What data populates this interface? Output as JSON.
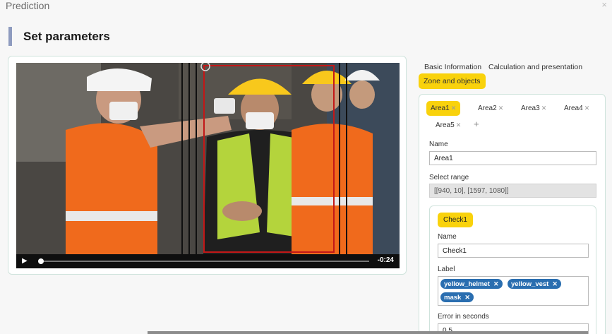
{
  "window": {
    "title": "Prediction",
    "close_icon": "close-icon"
  },
  "header": {
    "title": "Set parameters",
    "accent_color": "#8e9bbf"
  },
  "video": {
    "time_remaining": "-0:24",
    "progress": 0.0
  },
  "tabs": [
    {
      "label": "Basic Information",
      "active": false
    },
    {
      "label": "Calculation and presentation",
      "active": false
    },
    {
      "label": "Zone and objects",
      "active": true
    }
  ],
  "areas": [
    {
      "label": "Area1",
      "active": true
    },
    {
      "label": "Area2",
      "active": false
    },
    {
      "label": "Area3",
      "active": false
    },
    {
      "label": "Area4",
      "active": false
    },
    {
      "label": "Area5",
      "active": false
    }
  ],
  "area_add_label": "+",
  "remove_glyph": "✕",
  "form": {
    "name_label": "Name",
    "name_value": "Area1",
    "range_label": "Select range",
    "range_value": "[[940, 10], [1597, 1080]]"
  },
  "check": {
    "chip_label": "Check1",
    "name_label": "Name",
    "name_value": "Check1",
    "label_label": "Label",
    "tags": [
      "yellow_helmet",
      "yellow_vest",
      "mask"
    ],
    "error_label": "Error in seconds",
    "error_value": "0.5"
  },
  "colors": {
    "active_tab": "#f9d20c",
    "tag": "#2a6eb0",
    "panel_border": "#cfe3dc"
  }
}
